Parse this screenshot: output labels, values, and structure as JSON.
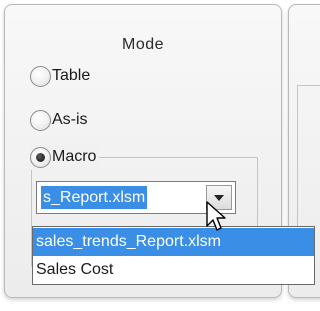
{
  "mode_panel": {
    "title": "Mode",
    "options": [
      {
        "label": "Table",
        "checked": false
      },
      {
        "label": "As-is",
        "checked": false
      },
      {
        "label": "Macro",
        "checked": true
      }
    ]
  },
  "macro_group": {
    "combo": {
      "value": "s_Report.xlsm"
    },
    "dropdown_options": [
      {
        "label": "sales_trends_Report.xlsm",
        "highlighted": true
      },
      {
        "label": "Sales Cost",
        "highlighted": false
      }
    ]
  },
  "colors": {
    "selection": "#3a8ee6"
  }
}
